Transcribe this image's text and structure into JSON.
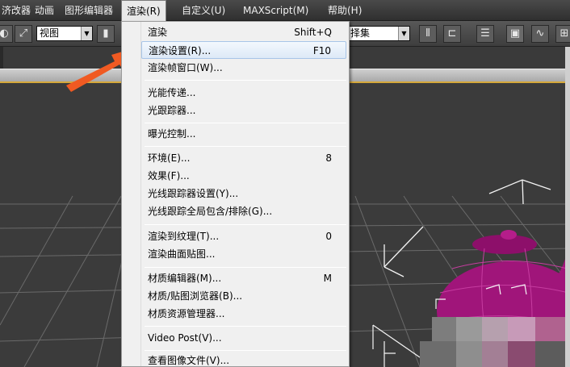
{
  "menubar": {
    "items": [
      {
        "label": "济改器"
      },
      {
        "label": "动画"
      },
      {
        "label": "图形编辑器"
      },
      {
        "label": "渲染(R)"
      },
      {
        "label": "自定义(U)"
      },
      {
        "label": "MAXScript(M)"
      },
      {
        "label": "帮助(H)"
      }
    ]
  },
  "toolbar": {
    "view_select": "视图",
    "selection_set": "择集"
  },
  "render_menu": {
    "items": [
      {
        "label": "渲染",
        "shortcut": "Shift+Q"
      },
      {
        "label": "渲染设置(R)...",
        "shortcut": "F10"
      },
      {
        "label": "渲染帧窗口(W)...",
        "shortcut": ""
      },
      {
        "label": "光能传递...",
        "shortcut": ""
      },
      {
        "label": "光跟踪器...",
        "shortcut": ""
      },
      {
        "label": "曝光控制...",
        "shortcut": ""
      },
      {
        "label": "环境(E)...",
        "shortcut": "8"
      },
      {
        "label": "效果(F)...",
        "shortcut": ""
      },
      {
        "label": "光线跟踪器设置(Y)...",
        "shortcut": ""
      },
      {
        "label": "光线跟踪全局包含/排除(G)...",
        "shortcut": ""
      },
      {
        "label": "渲染到纹理(T)...",
        "shortcut": "0"
      },
      {
        "label": "渲染曲面贴图...",
        "shortcut": ""
      },
      {
        "label": "材质编辑器(M)...",
        "shortcut": "M"
      },
      {
        "label": "材质/贴图浏览器(B)...",
        "shortcut": ""
      },
      {
        "label": "材质资源管理器...",
        "shortcut": ""
      },
      {
        "label": "Video Post(V)...",
        "shortcut": ""
      },
      {
        "label": "查看图像文件(V)...",
        "shortcut": ""
      }
    ]
  },
  "colors": {
    "arrow": "#f05a22",
    "teapot": "#a0157a",
    "highlight": "#dde9f7"
  }
}
